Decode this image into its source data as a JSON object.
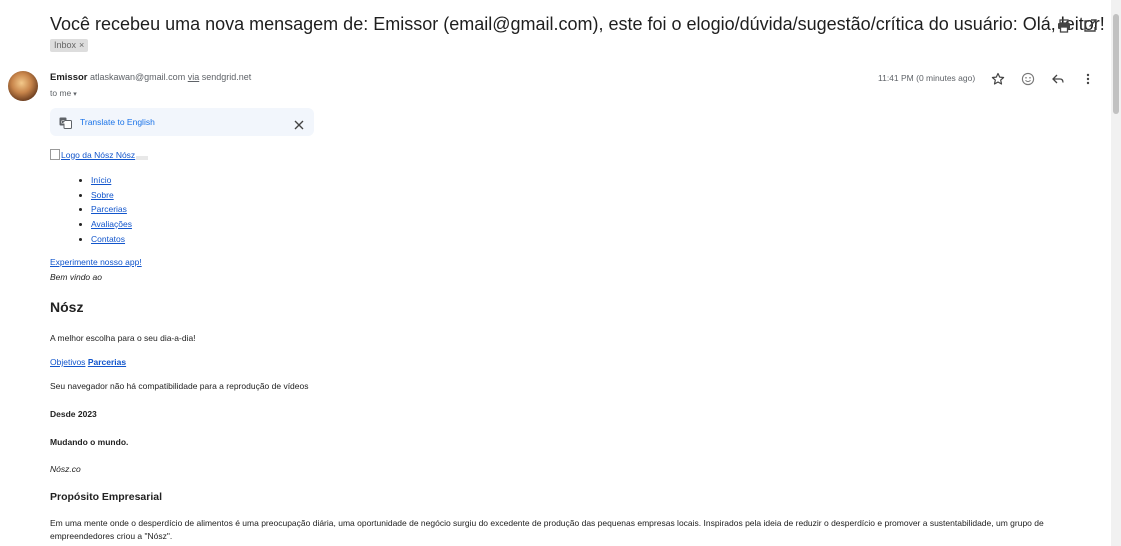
{
  "subject": "Você recebeu uma nova mensagem de: Emissor (email@gmail.com), este foi o elogio/dúvida/sugestão/crítica do usuário: Olá, leitor! :)",
  "label": {
    "name": "Inbox",
    "remove": "×"
  },
  "sender": {
    "name": "Emissor",
    "email": "atlaskawan@gmail.com",
    "via_word": "via",
    "via_domain": "sendgrid.net",
    "recipient": "to me",
    "caret": "▾"
  },
  "timestamp": "11:41 PM (0 minutes ago)",
  "translate": {
    "link": "Translate to English"
  },
  "body": {
    "logo_alt": "Logo da Nósz Nósz",
    "nav": [
      "Início",
      "Sobre",
      "Parcerias",
      "Avaliações",
      "Contatos"
    ],
    "app_link": "Experimente nosso app!",
    "welcome": "Bem vindo ao",
    "brand": "Nósz",
    "tagline": "A melhor escolha para o seu dia-a-dia!",
    "objetivos": "Objetivos",
    "parcerias": "Parcerias",
    "video_notice": "Seu navegador não há compatibilidade para a reprodução de vídeos",
    "since": "Desde 2023",
    "changing": "Mudando o mundo.",
    "domain": "Nósz.co",
    "purpose_title": "Propósito Empresarial",
    "purpose_text": "Em uma mente onde o desperdício de alimentos é uma preocupação diária, uma oportunidade de negócio surgiu do excedente de produção das pequenas empresas locais. Inspirados pela ideia de reduzir o desperdício e promover a sustentabilidade, um grupo de empreendedores criou a \"Nósz\"."
  },
  "icons": {
    "print": "printer-icon",
    "new_window": "open-in-new-window-icon",
    "star": "star-icon",
    "emoji": "emoji-reaction-icon",
    "reply": "reply-icon",
    "more": "more-vert-icon",
    "translate": "translate-icon",
    "close": "close-icon"
  }
}
